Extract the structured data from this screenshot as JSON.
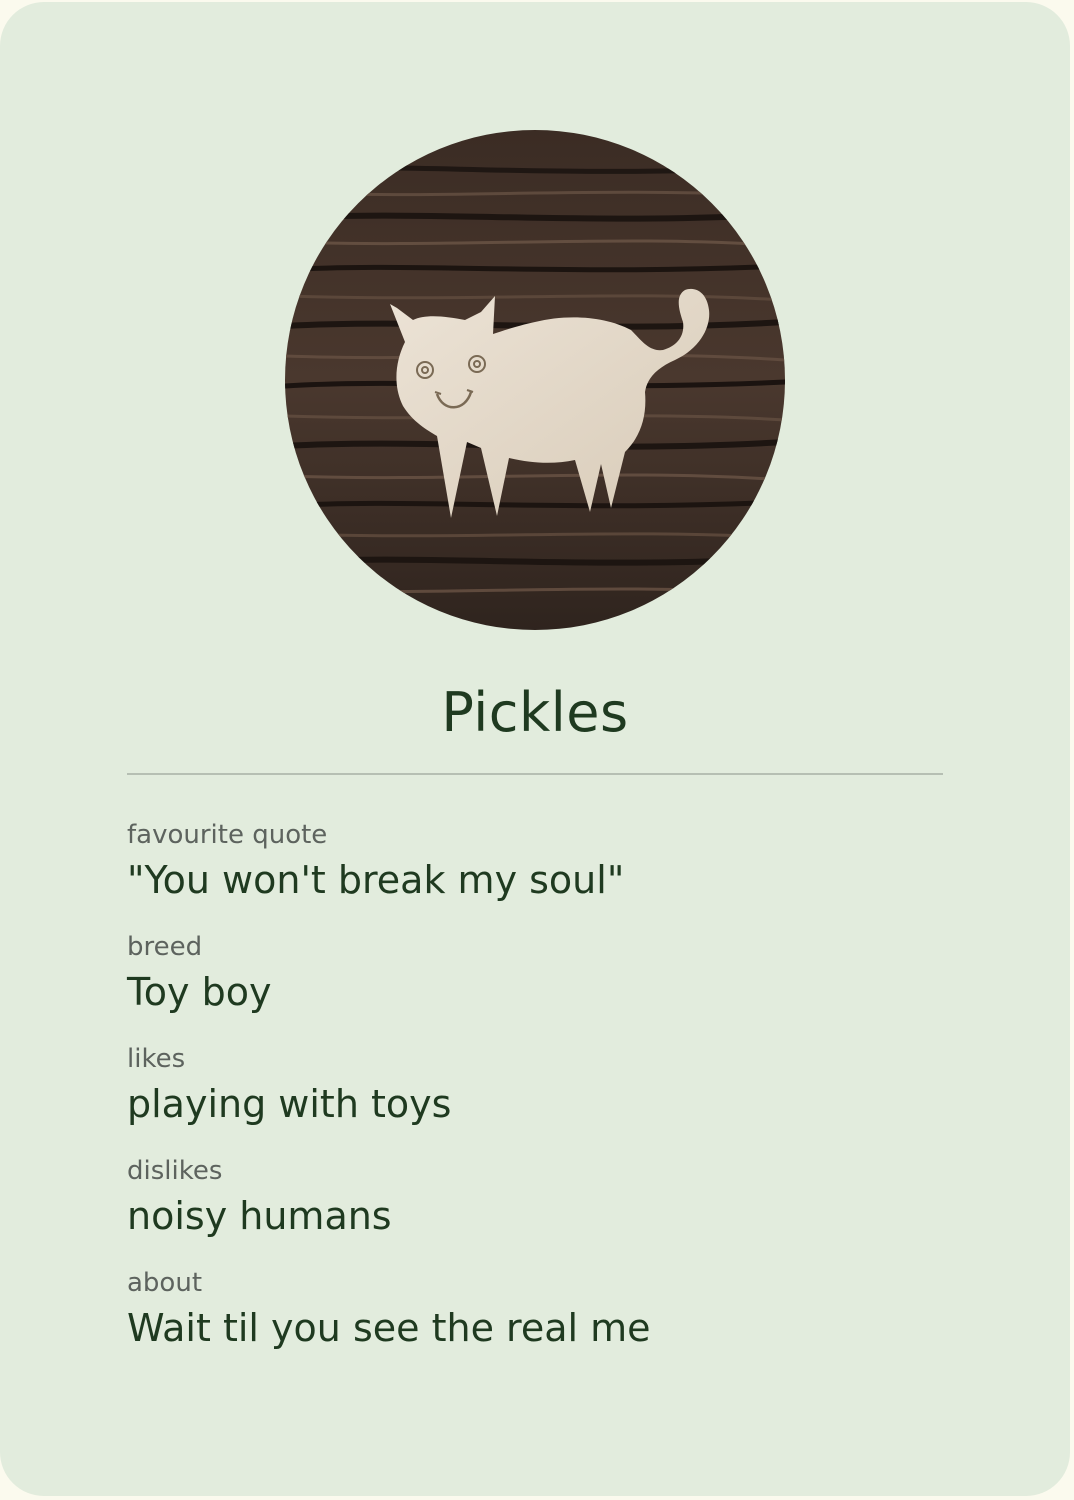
{
  "profile": {
    "photo_icon": "cat-figure-on-wood-photo",
    "name": "Pickles",
    "fields": [
      {
        "label": "favourite quote",
        "value": "\"You won't break my soul\""
      },
      {
        "label": "breed",
        "value": "Toy boy"
      },
      {
        "label": "likes",
        "value": "playing with toys"
      },
      {
        "label": "dislikes",
        "value": "noisy humans"
      },
      {
        "label": "about",
        "value": "Wait til you see the real me"
      }
    ]
  },
  "colors": {
    "page_background": "#fbfaee",
    "card_background": "#e2ecdd",
    "name_text": "#1f3a20",
    "label_text": "#5d635e",
    "divider": "#b6bfb3"
  }
}
